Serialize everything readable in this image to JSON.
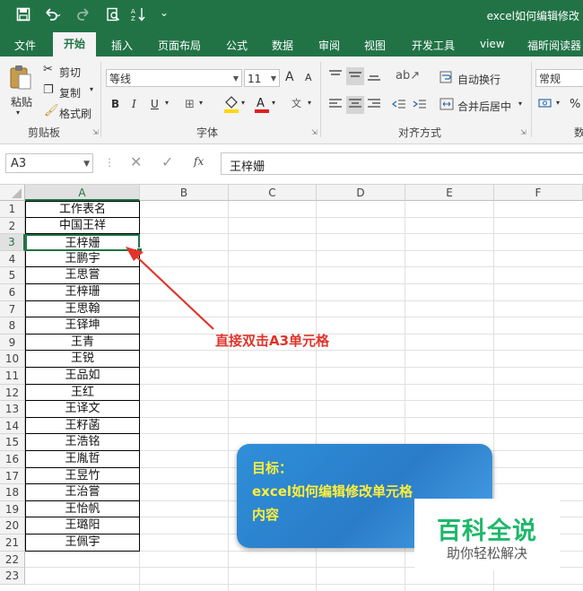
{
  "titlebar": {
    "title": "excel如何编辑修改",
    "save_icon": "save-icon",
    "undo_icon": "undo-icon",
    "redo_icon": "redo-icon",
    "preview_icon": "print-preview-icon",
    "sort_icon": "sort-icon",
    "customize": "⌄"
  },
  "menu": [
    "文件",
    "开始",
    "插入",
    "页面布局",
    "公式",
    "数据",
    "审阅",
    "视图",
    "开发工具",
    "view",
    "福昕阅读器"
  ],
  "ribbon": {
    "clipboard": {
      "paste": "粘贴",
      "cut": "剪切",
      "copy": "复制",
      "format_painter": "格式刷",
      "label": "剪贴板"
    },
    "font": {
      "name": "等线",
      "size": "11",
      "bold": "B",
      "italic": "I",
      "underline": "U",
      "grow": "A",
      "shrink": "A",
      "label": "字体",
      "font_color": "#e02020",
      "fill_color": "#ffd800"
    },
    "alignment": {
      "wrap": "自动换行",
      "merge": "合并后居中",
      "label": "对齐方式"
    },
    "number": {
      "format": "常规",
      "percent": "%",
      "label": "数"
    }
  },
  "formula_bar": {
    "name_box": "A3",
    "fx": "fx",
    "value": "王梓姗"
  },
  "grid": {
    "columns": [
      "A",
      "B",
      "C",
      "D",
      "E",
      "F"
    ],
    "rows": [
      "1",
      "2",
      "3",
      "4",
      "5",
      "6",
      "7",
      "8",
      "9",
      "10",
      "11",
      "12",
      "13",
      "14",
      "15",
      "16",
      "17",
      "18",
      "19",
      "20",
      "21",
      "22",
      "23"
    ],
    "colA": [
      "工作表名",
      "中国王祥",
      "王梓姗",
      "王鹏宇",
      "王思嘗",
      "王梓珊",
      "王思翰",
      "王铎坤",
      "王青",
      "王锐",
      "王品如",
      "王红",
      "王译文",
      "王籽菡",
      "王浩铭",
      "王胤哲",
      "王昱竹",
      "王治嘗",
      "王怡帆",
      "王璐阳",
      "王佩宇"
    ],
    "selected_cell": "A3",
    "accent": "#217346"
  },
  "annotation": "直接双击A3单元格",
  "callout": {
    "line1": "目标：",
    "line2": "excel如何编辑修改单元格",
    "line3": "内容"
  },
  "logo": {
    "name": "百科全说",
    "slogan": "助你轻松解决"
  }
}
